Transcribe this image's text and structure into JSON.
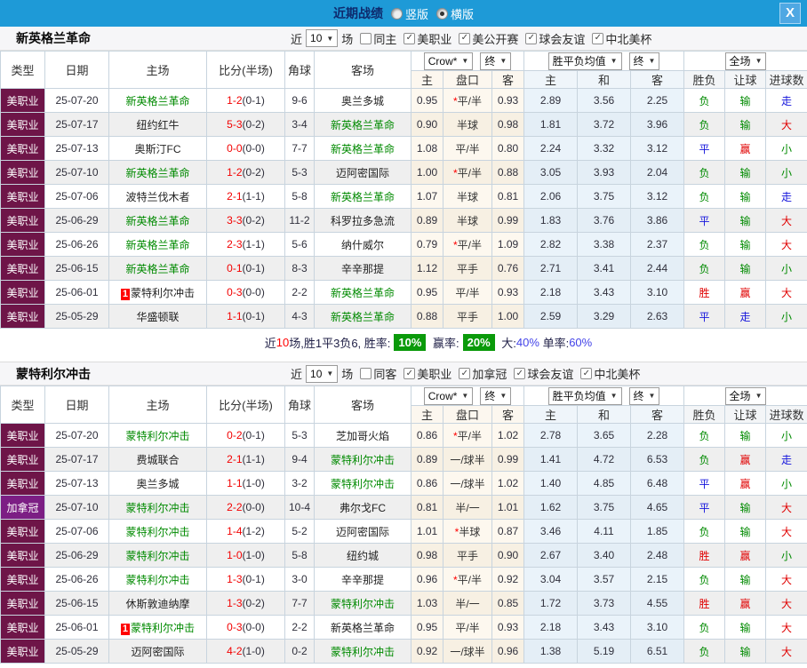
{
  "titlebar": {
    "title": "近期战绩",
    "vertical_label": "竖版",
    "horizontal_label": "横版",
    "selected_mode": "横版",
    "close_label": "X"
  },
  "table": {
    "columns": [
      "类型",
      "日期",
      "主场",
      "比分(半场)",
      "角球",
      "客场"
    ],
    "subcolumns": [
      "主",
      "盘口",
      "客",
      "主",
      "和",
      "客",
      "胜负",
      "让球",
      "进球数"
    ],
    "dropdowns": {
      "bookmaker": "Crow*",
      "final_left": "终",
      "average": "胜平负均值",
      "final_right": "终",
      "scope": "全场"
    }
  },
  "filter_shared": {
    "near_label": "近",
    "count": "10",
    "games_label": "场"
  },
  "sections": [
    {
      "team": "新英格兰革命",
      "filter": {
        "same_label": "同主",
        "same_checked": false,
        "leagues": [
          "美职业",
          "美公开赛",
          "球会友谊",
          "中北美杯"
        ]
      },
      "rows": [
        {
          "league": "美职业",
          "league_color": "maroon",
          "date": "25-07-20",
          "home": "新英格兰革命",
          "home_highlight": true,
          "home_badge": "",
          "score": "1-2",
          "half": "(0-1)",
          "corners": "9-6",
          "away": "奥兰多城",
          "away_highlight": false,
          "away_badge": "",
          "odds_home": "0.95",
          "handicap": "*平/半",
          "odds_away": "0.93",
          "avg_win": "2.89",
          "avg_draw": "3.56",
          "avg_lose": "2.25",
          "result": "负",
          "handicap_result": "输",
          "goals_result": "走"
        },
        {
          "league": "美职业",
          "league_color": "maroon",
          "date": "25-07-17",
          "home": "纽约红牛",
          "home_highlight": false,
          "home_badge": "",
          "score": "5-3",
          "half": "(0-2)",
          "corners": "3-4",
          "away": "新英格兰革命",
          "away_highlight": true,
          "away_badge": "",
          "odds_home": "0.90",
          "handicap": "半球",
          "odds_away": "0.98",
          "avg_win": "1.81",
          "avg_draw": "3.72",
          "avg_lose": "3.96",
          "result": "负",
          "handicap_result": "输",
          "goals_result": "大"
        },
        {
          "league": "美职业",
          "league_color": "maroon",
          "date": "25-07-13",
          "home": "奥斯汀FC",
          "home_highlight": false,
          "home_badge": "",
          "score": "0-0",
          "half": "(0-0)",
          "corners": "7-7",
          "away": "新英格兰革命",
          "away_highlight": true,
          "away_badge": "",
          "odds_home": "1.08",
          "handicap": "平/半",
          "odds_away": "0.80",
          "avg_win": "2.24",
          "avg_draw": "3.32",
          "avg_lose": "3.12",
          "result": "平",
          "handicap_result": "赢",
          "goals_result": "小"
        },
        {
          "league": "美职业",
          "league_color": "maroon",
          "date": "25-07-10",
          "home": "新英格兰革命",
          "home_highlight": true,
          "home_badge": "",
          "score": "1-2",
          "half": "(0-2)",
          "corners": "5-3",
          "away": "迈阿密国际",
          "away_highlight": false,
          "away_badge": "",
          "odds_home": "1.00",
          "handicap": "*平/半",
          "odds_away": "0.88",
          "avg_win": "3.05",
          "avg_draw": "3.93",
          "avg_lose": "2.04",
          "result": "负",
          "handicap_result": "输",
          "goals_result": "小"
        },
        {
          "league": "美职业",
          "league_color": "maroon",
          "date": "25-07-06",
          "home": "波特兰伐木者",
          "home_highlight": false,
          "home_badge": "",
          "score": "2-1",
          "half": "(1-1)",
          "corners": "5-8",
          "away": "新英格兰革命",
          "away_highlight": true,
          "away_badge": "",
          "odds_home": "1.07",
          "handicap": "半球",
          "odds_away": "0.81",
          "avg_win": "2.06",
          "avg_draw": "3.75",
          "avg_lose": "3.12",
          "result": "负",
          "handicap_result": "输",
          "goals_result": "走"
        },
        {
          "league": "美职业",
          "league_color": "maroon",
          "date": "25-06-29",
          "home": "新英格兰革命",
          "home_highlight": true,
          "home_badge": "",
          "score": "3-3",
          "half": "(0-2)",
          "corners": "11-2",
          "away": "科罗拉多急流",
          "away_highlight": false,
          "away_badge": "",
          "odds_home": "0.89",
          "handicap": "半球",
          "odds_away": "0.99",
          "avg_win": "1.83",
          "avg_draw": "3.76",
          "avg_lose": "3.86",
          "result": "平",
          "handicap_result": "输",
          "goals_result": "大"
        },
        {
          "league": "美职业",
          "league_color": "maroon",
          "date": "25-06-26",
          "home": "新英格兰革命",
          "home_highlight": true,
          "home_badge": "",
          "score": "2-3",
          "half": "(1-1)",
          "corners": "5-6",
          "away": "纳什威尔",
          "away_highlight": false,
          "away_badge": "",
          "odds_home": "0.79",
          "handicap": "*平/半",
          "odds_away": "1.09",
          "avg_win": "2.82",
          "avg_draw": "3.38",
          "avg_lose": "2.37",
          "result": "负",
          "handicap_result": "输",
          "goals_result": "大"
        },
        {
          "league": "美职业",
          "league_color": "maroon",
          "date": "25-06-15",
          "home": "新英格兰革命",
          "home_highlight": true,
          "home_badge": "",
          "score": "0-1",
          "half": "(0-1)",
          "corners": "8-3",
          "away": "辛辛那提",
          "away_highlight": false,
          "away_badge": "",
          "odds_home": "1.12",
          "handicap": "平手",
          "odds_away": "0.76",
          "avg_win": "2.71",
          "avg_draw": "3.41",
          "avg_lose": "2.44",
          "result": "负",
          "handicap_result": "输",
          "goals_result": "小"
        },
        {
          "league": "美职业",
          "league_color": "maroon",
          "date": "25-06-01",
          "home": "蒙特利尔冲击",
          "home_highlight": false,
          "home_badge": "1",
          "score": "0-3",
          "half": "(0-0)",
          "corners": "2-2",
          "away": "新英格兰革命",
          "away_highlight": true,
          "away_badge": "",
          "odds_home": "0.95",
          "handicap": "平/半",
          "odds_away": "0.93",
          "avg_win": "2.18",
          "avg_draw": "3.43",
          "avg_lose": "3.10",
          "result": "胜",
          "handicap_result": "赢",
          "goals_result": "大"
        },
        {
          "league": "美职业",
          "league_color": "maroon",
          "date": "25-05-29",
          "home": "华盛顿联",
          "home_highlight": false,
          "home_badge": "",
          "score": "1-1",
          "half": "(0-1)",
          "corners": "4-3",
          "away": "新英格兰革命",
          "away_highlight": true,
          "away_badge": "",
          "odds_home": "0.88",
          "handicap": "平手",
          "odds_away": "1.00",
          "avg_win": "2.59",
          "avg_draw": "3.29",
          "avg_lose": "2.63",
          "result": "平",
          "handicap_result": "走",
          "goals_result": "小"
        }
      ],
      "stats_segments": [
        {
          "text": "近",
          "style": "plain"
        },
        {
          "text": "10",
          "style": "red"
        },
        {
          "text": "场,胜1平3负6, 胜率:",
          "style": "plain"
        },
        {
          "text": "10%",
          "style": "greenbox"
        },
        {
          "text": " 赢率:",
          "style": "plain"
        },
        {
          "text": "20%",
          "style": "greenbox"
        },
        {
          "text": " 大:",
          "style": "plain"
        },
        {
          "text": "40%",
          "style": "blue"
        },
        {
          "text": " 单率:",
          "style": "plain"
        },
        {
          "text": "60%",
          "style": "blue"
        }
      ]
    },
    {
      "team": "蒙特利尔冲击",
      "filter": {
        "same_label": "同客",
        "same_checked": false,
        "leagues": [
          "美职业",
          "加拿冠",
          "球会友谊",
          "中北美杯"
        ]
      },
      "rows": [
        {
          "league": "美职业",
          "league_color": "maroon",
          "date": "25-07-20",
          "home": "蒙特利尔冲击",
          "home_highlight": true,
          "home_badge": "",
          "score": "0-2",
          "half": "(0-1)",
          "corners": "5-3",
          "away": "芝加哥火焰",
          "away_highlight": false,
          "away_badge": "",
          "odds_home": "0.86",
          "handicap": "*平/半",
          "odds_away": "1.02",
          "avg_win": "2.78",
          "avg_draw": "3.65",
          "avg_lose": "2.28",
          "result": "负",
          "handicap_result": "输",
          "goals_result": "小"
        },
        {
          "league": "美职业",
          "league_color": "maroon",
          "date": "25-07-17",
          "home": "费城联合",
          "home_highlight": false,
          "home_badge": "",
          "score": "2-1",
          "half": "(1-1)",
          "corners": "9-4",
          "away": "蒙特利尔冲击",
          "away_highlight": true,
          "away_badge": "",
          "odds_home": "0.89",
          "handicap": "一/球半",
          "odds_away": "0.99",
          "avg_win": "1.41",
          "avg_draw": "4.72",
          "avg_lose": "6.53",
          "result": "负",
          "handicap_result": "赢",
          "goals_result": "走"
        },
        {
          "league": "美职业",
          "league_color": "maroon",
          "date": "25-07-13",
          "home": "奥兰多城",
          "home_highlight": false,
          "home_badge": "",
          "score": "1-1",
          "half": "(1-0)",
          "corners": "3-2",
          "away": "蒙特利尔冲击",
          "away_highlight": true,
          "away_badge": "",
          "odds_home": "0.86",
          "handicap": "一/球半",
          "odds_away": "1.02",
          "avg_win": "1.40",
          "avg_draw": "4.85",
          "avg_lose": "6.48",
          "result": "平",
          "handicap_result": "赢",
          "goals_result": "小"
        },
        {
          "league": "加拿冠",
          "league_color": "purple",
          "date": "25-07-10",
          "home": "蒙特利尔冲击",
          "home_highlight": true,
          "home_badge": "",
          "score": "2-2",
          "half": "(0-0)",
          "corners": "10-4",
          "away": "弗尔戈FC",
          "away_highlight": false,
          "away_badge": "",
          "odds_home": "0.81",
          "handicap": "半/一",
          "odds_away": "1.01",
          "avg_win": "1.62",
          "avg_draw": "3.75",
          "avg_lose": "4.65",
          "result": "平",
          "handicap_result": "输",
          "goals_result": "大"
        },
        {
          "league": "美职业",
          "league_color": "maroon",
          "date": "25-07-06",
          "home": "蒙特利尔冲击",
          "home_highlight": true,
          "home_badge": "",
          "score": "1-4",
          "half": "(1-2)",
          "corners": "5-2",
          "away": "迈阿密国际",
          "away_highlight": false,
          "away_badge": "",
          "odds_home": "1.01",
          "handicap": "*半球",
          "odds_away": "0.87",
          "avg_win": "3.46",
          "avg_draw": "4.11",
          "avg_lose": "1.85",
          "result": "负",
          "handicap_result": "输",
          "goals_result": "大"
        },
        {
          "league": "美职业",
          "league_color": "maroon",
          "date": "25-06-29",
          "home": "蒙特利尔冲击",
          "home_highlight": true,
          "home_badge": "",
          "score": "1-0",
          "half": "(1-0)",
          "corners": "5-8",
          "away": "纽约城",
          "away_highlight": false,
          "away_badge": "",
          "odds_home": "0.98",
          "handicap": "平手",
          "odds_away": "0.90",
          "avg_win": "2.67",
          "avg_draw": "3.40",
          "avg_lose": "2.48",
          "result": "胜",
          "handicap_result": "赢",
          "goals_result": "小"
        },
        {
          "league": "美职业",
          "league_color": "maroon",
          "date": "25-06-26",
          "home": "蒙特利尔冲击",
          "home_highlight": true,
          "home_badge": "",
          "score": "1-3",
          "half": "(0-1)",
          "corners": "3-0",
          "away": "辛辛那提",
          "away_highlight": false,
          "away_badge": "",
          "odds_home": "0.96",
          "handicap": "*平/半",
          "odds_away": "0.92",
          "avg_win": "3.04",
          "avg_draw": "3.57",
          "avg_lose": "2.15",
          "result": "负",
          "handicap_result": "输",
          "goals_result": "大"
        },
        {
          "league": "美职业",
          "league_color": "maroon",
          "date": "25-06-15",
          "home": "休斯敦迪纳摩",
          "home_highlight": false,
          "home_badge": "",
          "score": "1-3",
          "half": "(0-2)",
          "corners": "7-7",
          "away": "蒙特利尔冲击",
          "away_highlight": true,
          "away_badge": "",
          "odds_home": "1.03",
          "handicap": "半/一",
          "odds_away": "0.85",
          "avg_win": "1.72",
          "avg_draw": "3.73",
          "avg_lose": "4.55",
          "result": "胜",
          "handicap_result": "赢",
          "goals_result": "大"
        },
        {
          "league": "美职业",
          "league_color": "maroon",
          "date": "25-06-01",
          "home": "蒙特利尔冲击",
          "home_highlight": true,
          "home_badge": "1",
          "score": "0-3",
          "half": "(0-0)",
          "corners": "2-2",
          "away": "新英格兰革命",
          "away_highlight": false,
          "away_badge": "",
          "odds_home": "0.95",
          "handicap": "平/半",
          "odds_away": "0.93",
          "avg_win": "2.18",
          "avg_draw": "3.43",
          "avg_lose": "3.10",
          "result": "负",
          "handicap_result": "输",
          "goals_result": "大"
        },
        {
          "league": "美职业",
          "league_color": "maroon",
          "date": "25-05-29",
          "home": "迈阿密国际",
          "home_highlight": false,
          "home_badge": "",
          "score": "4-2",
          "half": "(1-0)",
          "corners": "0-2",
          "away": "蒙特利尔冲击",
          "away_highlight": true,
          "away_badge": "",
          "odds_home": "0.92",
          "handicap": "一/球半",
          "odds_away": "0.96",
          "avg_win": "1.38",
          "avg_draw": "5.19",
          "avg_lose": "6.51",
          "result": "负",
          "handicap_result": "输",
          "goals_result": "大"
        }
      ],
      "stats_segments": null
    }
  ]
}
